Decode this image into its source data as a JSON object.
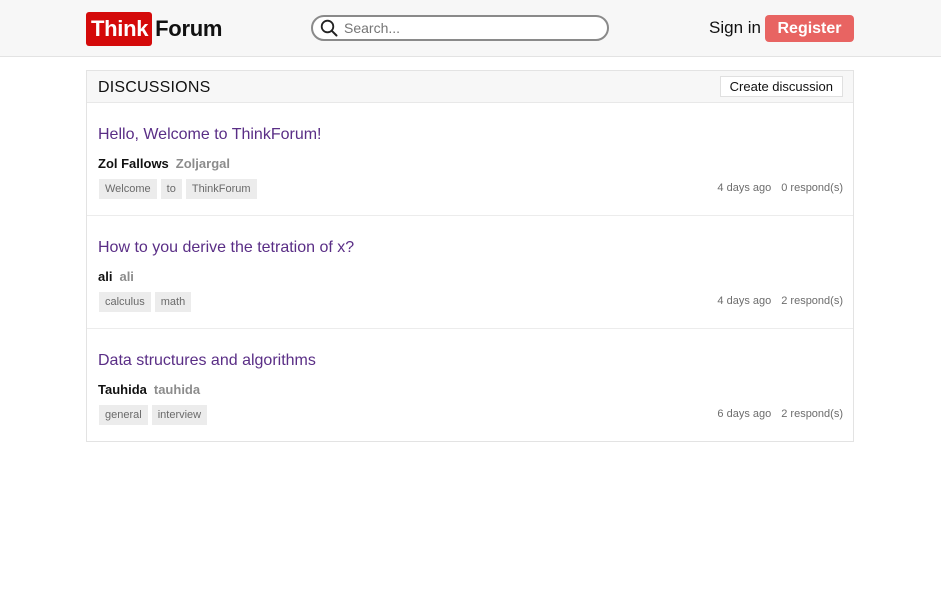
{
  "header": {
    "logo_think": "Think",
    "logo_forum": "Forum",
    "search_placeholder": "Search...",
    "signin_label": "Sign in",
    "register_label": "Register",
    "colors": {
      "logo_red": "#d40a0a",
      "register": "#e86462"
    }
  },
  "discussions": {
    "title": "DISCUSSIONS",
    "create_label": "Create discussion",
    "items": [
      {
        "title": "Hello, Welcome to ThinkForum!",
        "author_name": "Zol Fallows",
        "author_user": "Zoljargal",
        "tags": [
          "Welcome",
          "to",
          "ThinkForum"
        ],
        "time": "4 days ago",
        "responses": "0 respond(s)"
      },
      {
        "title": "How to you derive the tetration of x?",
        "author_name": "ali",
        "author_user": "ali",
        "tags": [
          "calculus",
          "math"
        ],
        "time": "4 days ago",
        "responses": "2 respond(s)"
      },
      {
        "title": "Data structures and algorithms",
        "author_name": "Tauhida",
        "author_user": "tauhida",
        "tags": [
          "general",
          "interview"
        ],
        "time": "6 days ago",
        "responses": "2 respond(s)"
      }
    ]
  }
}
